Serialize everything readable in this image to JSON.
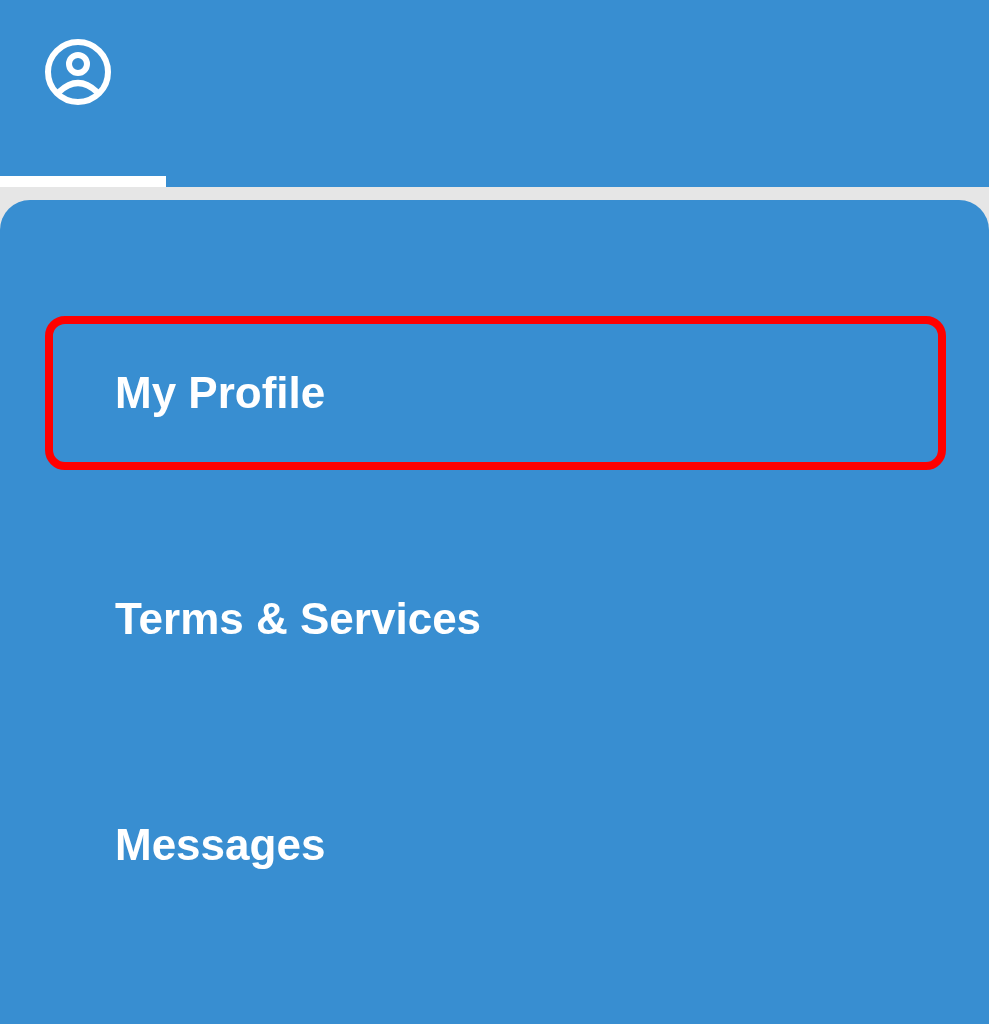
{
  "tabs": [
    {
      "selected": true
    }
  ],
  "menu": {
    "items": [
      {
        "label": "My Profile",
        "selected": true
      },
      {
        "label": "Terms & Services",
        "selected": false
      },
      {
        "label": "Messages",
        "selected": false
      }
    ]
  }
}
